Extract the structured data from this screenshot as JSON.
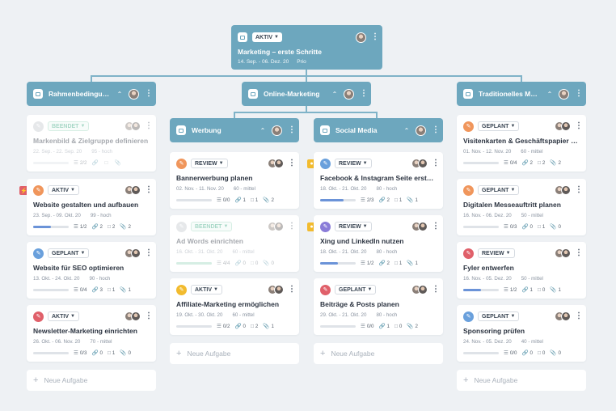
{
  "root": {
    "status": "AKTIV",
    "title": "Marketing – erste Schritte",
    "dates": "14. Sep. - 06. Dez. 20",
    "priority": "Prio"
  },
  "headers": {
    "col1": "Rahmenbedingun...",
    "col2": "Online-Marketing",
    "col2a": "Werbung",
    "col2b": "Social Media",
    "col3": "Traditionelles Mar..."
  },
  "add_task": "Neue Aufgabe",
  "colors": {
    "header": "#6da7be",
    "orange": "#f0965c",
    "blue": "#6aa0dc",
    "red": "#e0606a",
    "purple": "#8a7cd8",
    "yellow": "#f2bb2e",
    "gray": "#c4c9cf",
    "green": "#2ea27a"
  },
  "cards": {
    "c1a": {
      "status": "BEENDET",
      "title": "Markenbild & Zielgruppe definieren",
      "dates": "22. Sep. - 22. Sep. 20",
      "prio": "95 - hoch",
      "tasks": "2/2",
      "attach": "",
      "comments": "",
      "links": ""
    },
    "c1b": {
      "status": "AKTIV",
      "title": "Website gestalten und aufbauen",
      "dates": "23. Sep. - 09. Okt. 20",
      "prio": "99 - hoch",
      "tasks": "1/2",
      "attach": "2",
      "comments": "2",
      "links": "2",
      "progress": 0.5
    },
    "c1c": {
      "status": "GEPLANT",
      "title": "Website für SEO optimieren",
      "dates": "13. Okt. - 24. Okt. 20",
      "prio": "90 - hoch",
      "tasks": "0/4",
      "attach": "3",
      "comments": "1",
      "links": "1",
      "progress": 0
    },
    "c1d": {
      "status": "AKTIV",
      "title": "Newsletter-Marketing einrichten",
      "dates": "26. Okt. - 06. Nov. 20",
      "prio": "70 - mittel",
      "tasks": "0/3",
      "attach": "0",
      "comments": "1",
      "links": "0",
      "progress": 0
    },
    "c2a": {
      "status": "REVIEW",
      "title": "Bannerwerbung planen",
      "dates": "02. Nov. - 11. Nov. 20",
      "prio": "60 - mittel",
      "tasks": "0/0",
      "attach": "1",
      "comments": "1",
      "links": "2",
      "progress": 0
    },
    "c2b": {
      "status": "BEENDET",
      "title": "Ad Words einrichten",
      "dates": "16. Okt. - 31. Okt. 20",
      "prio": "60 - mittel",
      "tasks": "4/4",
      "attach": "0",
      "comments": "0",
      "links": "0",
      "progress": 1
    },
    "c2c": {
      "status": "AKTIV",
      "title": "Affiliate-Marketing ermöglichen",
      "dates": "19. Okt. - 30. Okt. 20",
      "prio": "60 - mittel",
      "tasks": "0/2",
      "attach": "0",
      "comments": "2",
      "links": "1",
      "progress": 0
    },
    "c3a": {
      "status": "REVIEW",
      "title": "Facebook & Instagram Seite erstell...",
      "dates": "18. Okt. - 21. Okt. 20",
      "prio": "80 - hoch",
      "tasks": "2/3",
      "attach": "2",
      "comments": "1",
      "links": "1",
      "progress": 0.67
    },
    "c3b": {
      "status": "REVIEW",
      "title": "Xing und LinkedIn nutzen",
      "dates": "18. Okt. - 21. Okt. 20",
      "prio": "80 - hoch",
      "tasks": "1/2",
      "attach": "2",
      "comments": "1",
      "links": "1",
      "progress": 0.5
    },
    "c3c": {
      "status": "GEPLANT",
      "title": "Beiträge & Posts planen",
      "dates": "29. Okt. - 21. Okt. 20",
      "prio": "80 - hoch",
      "tasks": "0/0",
      "attach": "1",
      "comments": "0",
      "links": "2",
      "progress": 0
    },
    "c4a": {
      "status": "GEPLANT",
      "title": "Visitenkarten & Geschäftspapier en...",
      "dates": "01. Nov. - 12. Nov. 20",
      "prio": "60 - mittel",
      "tasks": "0/4",
      "attach": "2",
      "comments": "2",
      "links": "2",
      "progress": 0
    },
    "c4b": {
      "status": "GEPLANT",
      "title": "Digitalen Messeauftritt planen",
      "dates": "16. Nov. - 06. Dez. 20",
      "prio": "50 - mittel",
      "tasks": "0/3",
      "attach": "0",
      "comments": "1",
      "links": "0",
      "progress": 0
    },
    "c4c": {
      "status": "REVIEW",
      "title": "Fyler entwerfen",
      "dates": "16. Nov. - 05. Dez. 20",
      "prio": "50 - mittel",
      "tasks": "1/2",
      "attach": "1",
      "comments": "0",
      "links": "1",
      "progress": 0.5
    },
    "c4d": {
      "status": "GEPLANT",
      "title": "Sponsoring prüfen",
      "dates": "24. Nov. - 05. Dez. 20",
      "prio": "40 - mittel",
      "tasks": "0/0",
      "attach": "0",
      "comments": "0",
      "links": "0",
      "progress": 0
    }
  }
}
